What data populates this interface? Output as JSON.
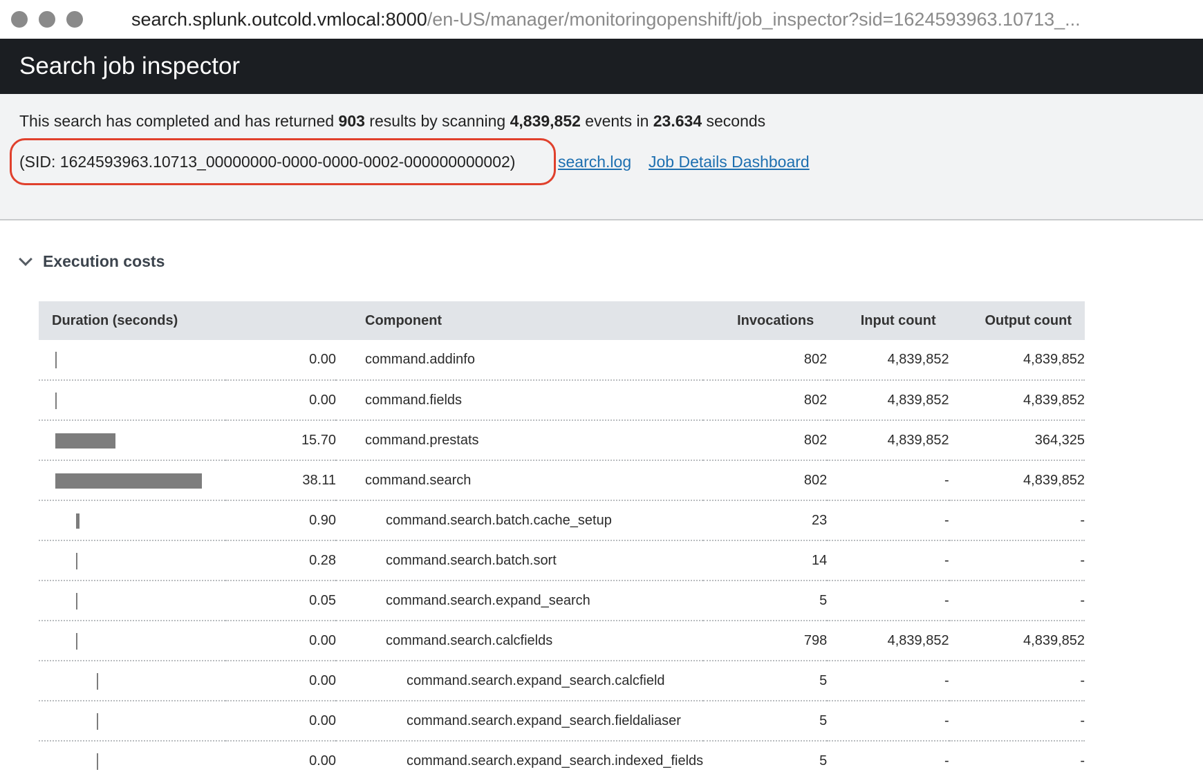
{
  "browser": {
    "url_host": "search.splunk.outcold.vmlocal:8000",
    "url_path": "/en-US/manager/monitoringopenshift/job_inspector?sid=1624593963.10713_..."
  },
  "header": {
    "title": "Search job inspector"
  },
  "summary": {
    "prefix": "This search has completed and has returned ",
    "results": "903",
    "mid1": " results by scanning ",
    "events": "4,839,852",
    "mid2": " events in ",
    "seconds": "23.634",
    "suffix": " seconds",
    "sid_text": "(SID: 1624593963.10713_00000000-0000-0000-0002-000000000002)",
    "search_log_link": "search.log",
    "dashboard_link": "Job Details Dashboard",
    "highlight_color": "#e0402c"
  },
  "section": {
    "title": "Execution costs"
  },
  "table": {
    "columns": [
      "Duration (seconds)",
      "Component",
      "Invocations",
      "Input count",
      "Output count"
    ],
    "rows": [
      {
        "duration": "0.00",
        "component": "command.addinfo",
        "level": 0,
        "invocations": "802",
        "input": "4,839,852",
        "output": "4,839,852"
      },
      {
        "duration": "0.00",
        "component": "command.fields",
        "level": 0,
        "invocations": "802",
        "input": "4,839,852",
        "output": "4,839,852"
      },
      {
        "duration": "15.70",
        "component": "command.prestats",
        "level": 0,
        "invocations": "802",
        "input": "4,839,852",
        "output": "364,325"
      },
      {
        "duration": "38.11",
        "component": "command.search",
        "level": 0,
        "invocations": "802",
        "input": "-",
        "output": "4,839,852"
      },
      {
        "duration": "0.90",
        "component": "command.search.batch.cache_setup",
        "level": 1,
        "invocations": "23",
        "input": "-",
        "output": "-"
      },
      {
        "duration": "0.28",
        "component": "command.search.batch.sort",
        "level": 1,
        "invocations": "14",
        "input": "-",
        "output": "-"
      },
      {
        "duration": "0.05",
        "component": "command.search.expand_search",
        "level": 1,
        "invocations": "5",
        "input": "-",
        "output": "-"
      },
      {
        "duration": "0.00",
        "component": "command.search.calcfields",
        "level": 1,
        "invocations": "798",
        "input": "4,839,852",
        "output": "4,839,852"
      },
      {
        "duration": "0.00",
        "component": "command.search.expand_search.calcfield",
        "level": 2,
        "invocations": "5",
        "input": "-",
        "output": "-"
      },
      {
        "duration": "0.00",
        "component": "command.search.expand_search.fieldaliaser",
        "level": 2,
        "invocations": "5",
        "input": "-",
        "output": "-"
      },
      {
        "duration": "0.00",
        "component": "command.search.expand_search.indexed_fields",
        "level": 2,
        "invocations": "5",
        "input": "-",
        "output": "-"
      }
    ]
  }
}
